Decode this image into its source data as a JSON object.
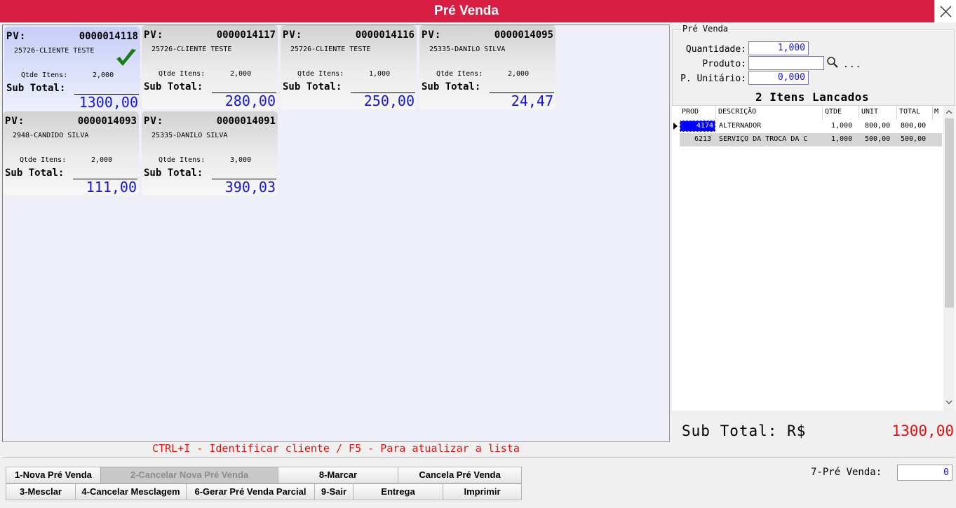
{
  "window": {
    "title": "Pré Venda"
  },
  "cards": [
    {
      "pv_label": "PV:",
      "pv_number": "0000014118",
      "client": "25726-CLIENTE TESTE",
      "qtde_label": "Qtde Itens:",
      "qtde_value": "2,000",
      "subtotal_label": "Sub Total:",
      "subtotal_value": "1300,00",
      "selected": true
    },
    {
      "pv_label": "PV:",
      "pv_number": "0000014117",
      "client": "25726-CLIENTE TESTE",
      "qtde_label": "Qtde Itens:",
      "qtde_value": "2,000",
      "subtotal_label": "Sub Total:",
      "subtotal_value": "280,00",
      "selected": false
    },
    {
      "pv_label": "PV:",
      "pv_number": "0000014116",
      "client": "25726-CLIENTE TESTE",
      "qtde_label": "Qtde Itens:",
      "qtde_value": "1,000",
      "subtotal_label": "Sub Total:",
      "subtotal_value": "250,00",
      "selected": false
    },
    {
      "pv_label": "PV:",
      "pv_number": "0000014095",
      "client": "25335-DANILO SILVA",
      "qtde_label": "Qtde Itens:",
      "qtde_value": "2,000",
      "subtotal_label": "Sub Total:",
      "subtotal_value": "24,47",
      "selected": false
    },
    {
      "pv_label": "PV:",
      "pv_number": "0000014093",
      "client": "2948-CANDIDO SILVA",
      "qtde_label": "Qtde Itens:",
      "qtde_value": "2,000",
      "subtotal_label": "Sub Total:",
      "subtotal_value": "111,00",
      "selected": false
    },
    {
      "pv_label": "PV:",
      "pv_number": "0000014091",
      "client": "25335-DANILO SILVA",
      "qtde_label": "Qtde Itens:",
      "qtde_value": "3,000",
      "subtotal_label": "Sub Total:",
      "subtotal_value": "390,03",
      "selected": false
    }
  ],
  "hint": "CTRL+I - Identificar cliente / F5 - Para atualizar a lista",
  "right": {
    "group_title": "Pré Venda",
    "quantidade_label": "Quantidade:",
    "quantidade_value": "1,000",
    "produto_label": "Produto:",
    "produto_value": "",
    "unitario_label": "P. Unitário:",
    "unitario_value": "0,000",
    "dots": "...",
    "items_count": "2 Itens Lancados",
    "grid": {
      "headers": [
        "PROD",
        "DESCRIÇÃO",
        "QTDE",
        "UNIT",
        "TOTAL",
        "M"
      ],
      "rows": [
        {
          "prod": "4174",
          "descricao": "ALTERNADOR",
          "qtde": "1,000",
          "unit": "800,00",
          "total": "800,00"
        },
        {
          "prod": "6213",
          "descricao": "SERVIÇO DA TROCA DA C",
          "qtde": "1,000",
          "unit": "500,00",
          "total": "500,00"
        }
      ]
    },
    "sub_total_label": "Sub Total: R$",
    "sub_total_value": "1300,00"
  },
  "buttons": {
    "nova": "1-Nova Pré Venda",
    "cancelar_nova": "2-Cancelar Nova Pré Venda",
    "marcar": "8-Marcar",
    "cancela": "Cancela Pré Venda",
    "mesclar": "3-Mesclar",
    "cancelar_mesclagem": "4-Cancelar Mesclagem",
    "gerar_parcial": "6-Gerar Pré Venda Parcial",
    "sair": "9-Sair",
    "entrega": "Entrega",
    "imprimir": "Imprimir"
  },
  "prevenda_field": {
    "label": "7-Pré Venda:",
    "value": "0"
  },
  "colors": {
    "title_bar": "#d81e43",
    "value_blue": "#1515d8",
    "alert_red": "#e01010"
  }
}
